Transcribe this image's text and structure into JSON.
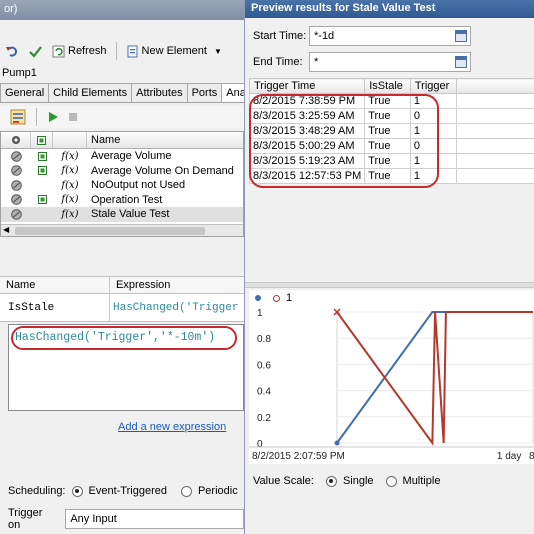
{
  "left": {
    "title": "or)",
    "toolbar": {
      "refresh_label": "Refresh",
      "new_element_label": "New Element"
    },
    "element_name": "Pump1",
    "tabs": [
      "General",
      "Child Elements",
      "Attributes",
      "Ports",
      "Anal"
    ],
    "grid": {
      "name_header": "Name",
      "rows": [
        {
          "name": "Average Volume",
          "has_status": true,
          "selected": false
        },
        {
          "name": "Average Volume On Demand",
          "has_status": true,
          "selected": false
        },
        {
          "name": "NoOutput not Used",
          "has_status": false,
          "selected": false
        },
        {
          "name": "Operation Test",
          "has_status": true,
          "selected": false
        },
        {
          "name": "Stale Value Test",
          "has_status": false,
          "selected": true
        }
      ]
    },
    "expressions": {
      "name_header": "Name",
      "expression_header": "Expression",
      "row": {
        "name": "IsStale",
        "expression": "HasChanged('Trigger"
      },
      "editor_text": "HasChanged('Trigger','*-10m')"
    },
    "add_expression_link": "Add a new expression",
    "scheduling": {
      "label": "Scheduling:",
      "option_event": "Event-Triggered",
      "option_periodic": "Periodic",
      "selected": "Event-Triggered"
    },
    "trigger_on": {
      "label": "Trigger on",
      "value": "Any Input"
    }
  },
  "right": {
    "title": "Preview results for Stale Value Test",
    "start_time": {
      "label": "Start Time:",
      "value": "*-1d"
    },
    "end_time": {
      "label": "End Time:",
      "value": "*"
    },
    "results": {
      "headers": [
        "Trigger Time",
        "IsStale",
        "Trigger"
      ],
      "rows": [
        [
          "8/2/2015 7:38:59 PM",
          "True",
          "1"
        ],
        [
          "8/3/2015 3:25:59 AM",
          "True",
          "0"
        ],
        [
          "8/3/2015 3:48:29 AM",
          "True",
          "1"
        ],
        [
          "8/3/2015 5:00:29 AM",
          "True",
          "0"
        ],
        [
          "8/3/2015 5:19:23 AM",
          "True",
          "1"
        ],
        [
          "8/3/2015 12:57:53 PM",
          "True",
          "1"
        ]
      ]
    },
    "chart_data": {
      "type": "line",
      "legend": [
        "",
        "1"
      ],
      "y_ticks": [
        "1",
        "0.8",
        "0.6",
        "0.4",
        "0.2",
        "0"
      ],
      "x_ticks": [
        "8/2/2015 2:07:59 PM",
        "1 day",
        "8"
      ],
      "ylim": [
        0,
        1
      ],
      "xlim": [
        "8/2/2015 2:07:59 PM",
        "8/3/2015 5:28 PM"
      ],
      "series": [
        {
          "name": "",
          "color": "#3e6fb0",
          "marker": "dot",
          "x": [
            "8/2/2015 2:07:59 PM",
            "8/3/2015 3:25:59 AM",
            "8/3/2015 5:28 PM"
          ],
          "values": [
            0,
            1,
            1
          ]
        },
        {
          "name": "1",
          "color": "#b5382c",
          "marker": "x",
          "x": [
            "8/2/2015 2:07:59 PM",
            "8/3/2015 3:25:59 AM",
            "8/3/2015 3:48:29 AM",
            "8/3/2015 5:00:29 AM",
            "8/3/2015 5:19:23 AM",
            "8/3/2015 12:57:53 PM",
            "8/3/2015 5:28 PM"
          ],
          "values": [
            1,
            0,
            1,
            0,
            1,
            1,
            1
          ]
        }
      ]
    },
    "value_scale": {
      "label": "Value Scale:",
      "option_single": "Single",
      "option_multiple": "Multiple",
      "selected": "Single"
    }
  }
}
